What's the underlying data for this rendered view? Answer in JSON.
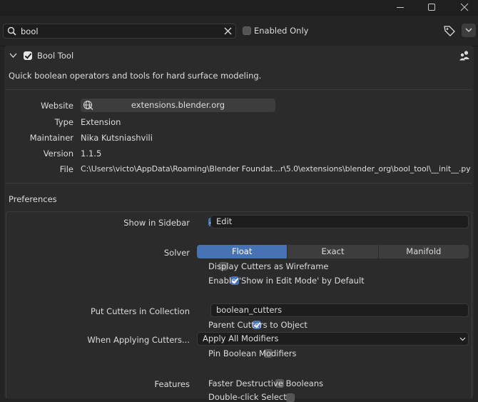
{
  "search": {
    "value": "bool",
    "enabled_only_label": "Enabled Only"
  },
  "addon": {
    "name": "Bool Tool",
    "description": "Quick boolean operators and tools for hard surface modeling.",
    "details": {
      "website_label": "Website",
      "website_value": "extensions.blender.org",
      "type_label": "Type",
      "type_value": "Extension",
      "maintainer_label": "Maintainer",
      "maintainer_value": "Nika Kutsniashvili",
      "version_label": "Version",
      "version_value": "1.1.5",
      "file_label": "File",
      "file_value": "C:\\Users\\victo\\AppData\\Roaming\\Blender Foundat...r\\5.0\\extensions\\blender_org\\bool_tool\\__init__.py"
    }
  },
  "preferences": {
    "title": "Preferences",
    "show_in_sidebar_label": "Show in Sidebar",
    "show_in_sidebar_value": "Edit",
    "solver_label": "Solver",
    "solver_options": [
      "Float",
      "Exact",
      "Manifold"
    ],
    "solver_selected": "Float",
    "display_wireframe_label": "Display Cutters as Wireframe",
    "enable_show_edit_label": "Enable 'Show in Edit Mode' by Default",
    "put_cutters_label": "Put Cutters in Collection",
    "collection_value": "boolean_cutters",
    "parent_cutters_label": "Parent Cutters to Object",
    "when_applying_label": "When Applying Cutters...",
    "when_applying_value": "Apply All Modifiers",
    "pin_boolean_label": "Pin Boolean Modifiers",
    "features_label": "Features",
    "faster_destructive_label": "Faster Destructive Booleans",
    "double_click_label": "Double-click Select"
  },
  "colors": {
    "accent": "#4772b3",
    "background": "#242424",
    "panel": "#2b2b2b",
    "field": "#3d3d3d"
  }
}
